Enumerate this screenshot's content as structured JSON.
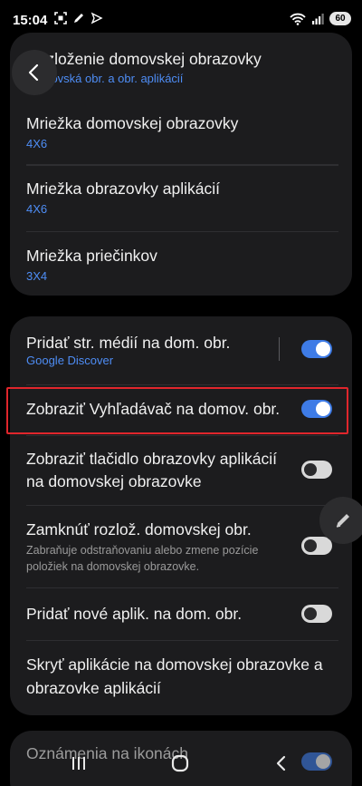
{
  "status_bar": {
    "time": "15:04",
    "battery": "60",
    "left_icons": [
      "screenshot-icon",
      "pen-icon",
      "send-icon"
    ],
    "right_icons": [
      "wifi-icon",
      "signal-icon",
      "battery-icon"
    ]
  },
  "card1": {
    "rows": [
      {
        "title": "Rozloženie domovskej obrazovky",
        "subtitle": "Domovská obr. a obr. aplikácií"
      },
      {
        "title": "Mriežka domovskej obrazovky",
        "subtitle": "4X6"
      },
      {
        "title": "Mriežka obrazovky aplikácií",
        "subtitle": "4X6"
      },
      {
        "title": "Mriežka priečinkov",
        "subtitle": "3X4"
      }
    ]
  },
  "card2": {
    "rows": [
      {
        "title": "Pridať str. médií na dom. obr.",
        "subtitle": "Google Discover",
        "toggle": true
      },
      {
        "title": "Zobraziť Vyhľadávač na domov. obr.",
        "toggle": true
      },
      {
        "title_line1": "Zobraziť tlačidlo obrazovky aplikácií",
        "title_line2": "na domovskej obrazovke",
        "toggle": false
      },
      {
        "title": "Zamknúť rozlož. domovskej obr.",
        "desc_line1": "Zabraňuje odstraňovaniu alebo zmene pozície",
        "desc_line2": "položiek na domovskej obrazovke.",
        "toggle": false
      },
      {
        "title": "Pridať nové aplik. na dom. obr.",
        "toggle": false
      },
      {
        "title_line1": "Skryť aplikácie na domovskej obrazovke a",
        "title_line2": "obrazovke aplikácií"
      }
    ]
  },
  "card3": {
    "rows": [
      {
        "title": "Oznámenia na ikonách",
        "toggle": true
      }
    ]
  },
  "colors": {
    "accent": "#3e7be6",
    "subtitle": "#4e8df5",
    "card": "#1c1c1e",
    "highlight": "#e0262c"
  }
}
